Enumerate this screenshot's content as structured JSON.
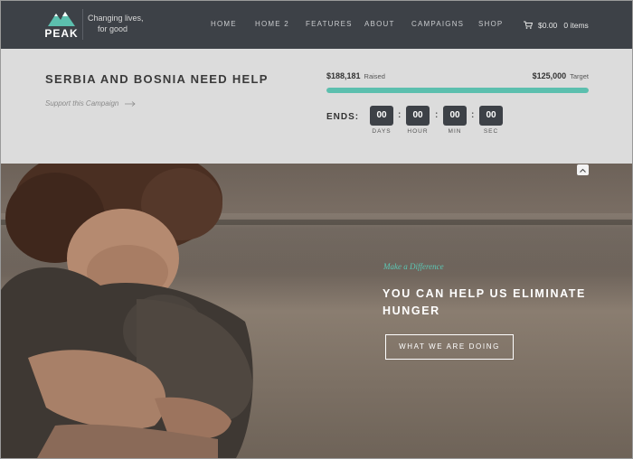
{
  "brand": {
    "name": "PEAK",
    "tagline_line1": "Changing lives,",
    "tagline_line2": "for good",
    "logo_color": "#5cbfae"
  },
  "nav": {
    "items": [
      "HOME",
      "HOME 2",
      "FEATURES",
      "ABOUT",
      "CAMPAIGNS",
      "SHOP"
    ]
  },
  "cart": {
    "icon": "shopping-cart-icon",
    "amount": "$0.00",
    "count": "0 items"
  },
  "campaign": {
    "title": "SERBIA AND BOSNIA NEED HELP",
    "support_link": "Support this Campaign",
    "raised_amount": "$188,181",
    "raised_label": "Raised",
    "target_amount": "$125,000",
    "target_label": "Target",
    "progress_fraction": 1.0,
    "progress_color": "#5cbfae",
    "ends_label": "ENDS:",
    "countdown": [
      {
        "value": "00",
        "unit": "DAYS"
      },
      {
        "value": "00",
        "unit": "HOUR"
      },
      {
        "value": "00",
        "unit": "MIN"
      },
      {
        "value": "00",
        "unit": "SEC"
      }
    ]
  },
  "hero": {
    "eyebrow": "Make a Difference",
    "headline": "YOU CAN HELP US ELIMINATE HUNGER",
    "cta_label": "WHAT WE ARE DOING",
    "accent_color": "#5cc7b5",
    "scroll_up_icon": "chevron-up-icon"
  }
}
